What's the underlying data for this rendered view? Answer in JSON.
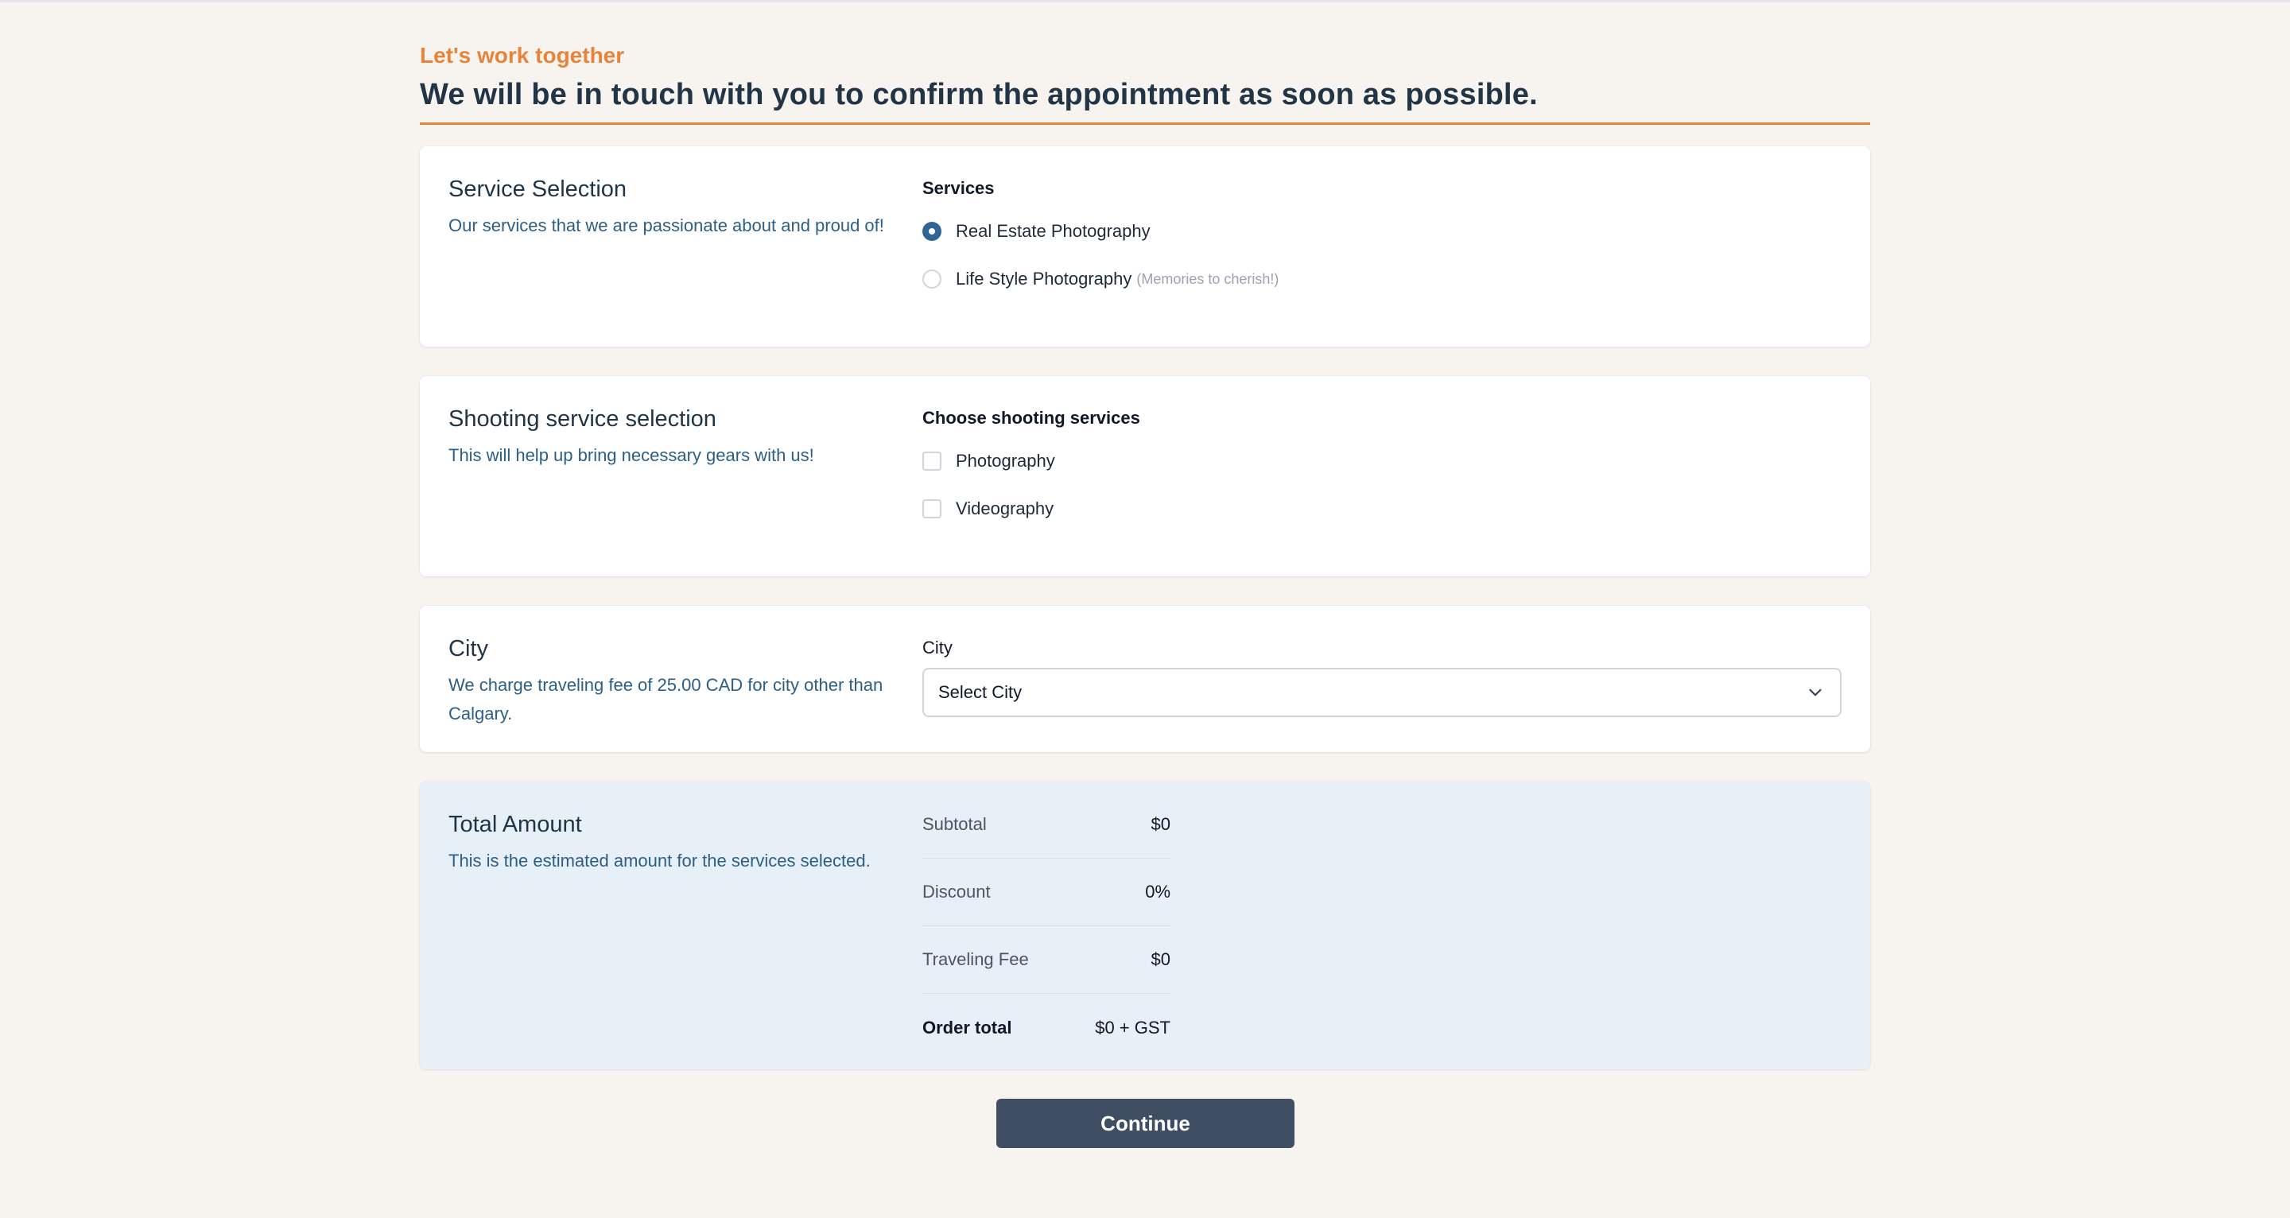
{
  "header": {
    "eyebrow": "Let's work together",
    "headline": "We will be in touch with you to confirm the appointment as soon as possible."
  },
  "service_selection": {
    "title": "Service Selection",
    "description": "Our services that we are passionate about and proud of!",
    "label": "Services",
    "options": [
      {
        "label": "Real Estate Photography",
        "note": "",
        "selected": true
      },
      {
        "label": "Life Style Photography",
        "note": "(Memories to cherish!)",
        "selected": false
      }
    ]
  },
  "shooting": {
    "title": "Shooting service selection",
    "description": "This will help up bring necessary gears with us!",
    "label": "Choose shooting services",
    "options": [
      {
        "label": "Photography",
        "checked": false
      },
      {
        "label": "Videography",
        "checked": false
      }
    ]
  },
  "city": {
    "title": "City",
    "description": "We charge traveling fee of 25.00 CAD for city other than Calgary.",
    "label": "City",
    "select_value": "Select City"
  },
  "total": {
    "title": "Total Amount",
    "description": "This is the estimated amount for the services selected.",
    "rows": [
      {
        "label": "Subtotal",
        "value": "$0"
      },
      {
        "label": "Discount",
        "value": "0%"
      },
      {
        "label": "Traveling Fee",
        "value": "$0"
      },
      {
        "label": "Order total",
        "value": "$0 + GST"
      }
    ]
  },
  "actions": {
    "continue_label": "Continue"
  },
  "colors": {
    "accent": "#e8833a",
    "primary": "#2f6596",
    "button": "#3f4e62"
  }
}
